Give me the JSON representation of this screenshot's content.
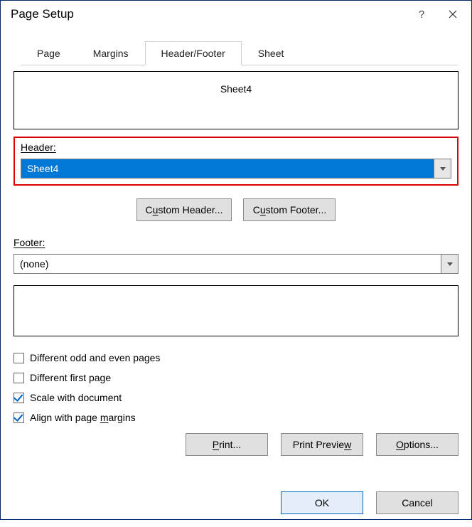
{
  "title": "Page Setup",
  "titlebar": {
    "help": "?",
    "close": ""
  },
  "tabs": {
    "page": "Page",
    "margins": "Margins",
    "headerfooter": "Header/Footer",
    "sheet": "Sheet"
  },
  "headerPreview": "Sheet4",
  "labels": {
    "header": "Header:",
    "footer": "Footer:"
  },
  "combos": {
    "header": "Sheet4",
    "footer": "(none)"
  },
  "buttons": {
    "customHeader_pre": "C",
    "customHeader_u": "u",
    "customHeader_suf": "stom Header...",
    "customFooter_pre": "C",
    "customFooter_u": "u",
    "customFooter_suf": "stom Footer...",
    "print_u": "P",
    "print_suf": "rint...",
    "printPreview_pre": "Print Previe",
    "printPreview_u": "w",
    "options_u": "O",
    "options_suf": "ptions...",
    "ok": "OK",
    "cancel": "Cancel"
  },
  "checks": {
    "diffOddEven": "Different odd and even pages",
    "diffFirst": "Different first page",
    "scale": "Scale with document",
    "align_pre": "Align with page ",
    "align_u": "m",
    "align_suf": "argins"
  }
}
